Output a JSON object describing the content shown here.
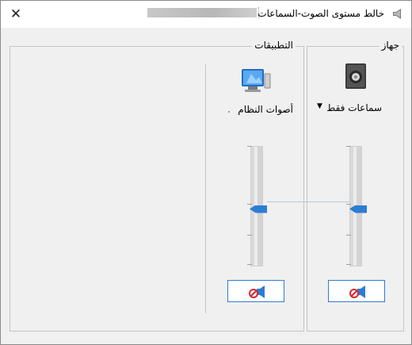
{
  "window": {
    "title": "خالط مستوى الصوت-السماعات",
    "close_glyph": "✕"
  },
  "groups": {
    "device": {
      "label": "جهاز"
    },
    "applications": {
      "label": "التطبيقات"
    }
  },
  "device": {
    "name": "سماعات فقط",
    "icon": "speaker-icon",
    "dropdown_glyph": "▼",
    "volume_level": 0.47,
    "mute_icon": "speaker-muted-icon"
  },
  "apps": [
    {
      "name": "أصوات النظام",
      "icon": "system-sounds-icon",
      "volume_level": 0.47,
      "mute_icon": "speaker-muted-icon"
    }
  ],
  "colors": {
    "accent": "#2d7dd2",
    "mute_badge": "#d9262c"
  }
}
